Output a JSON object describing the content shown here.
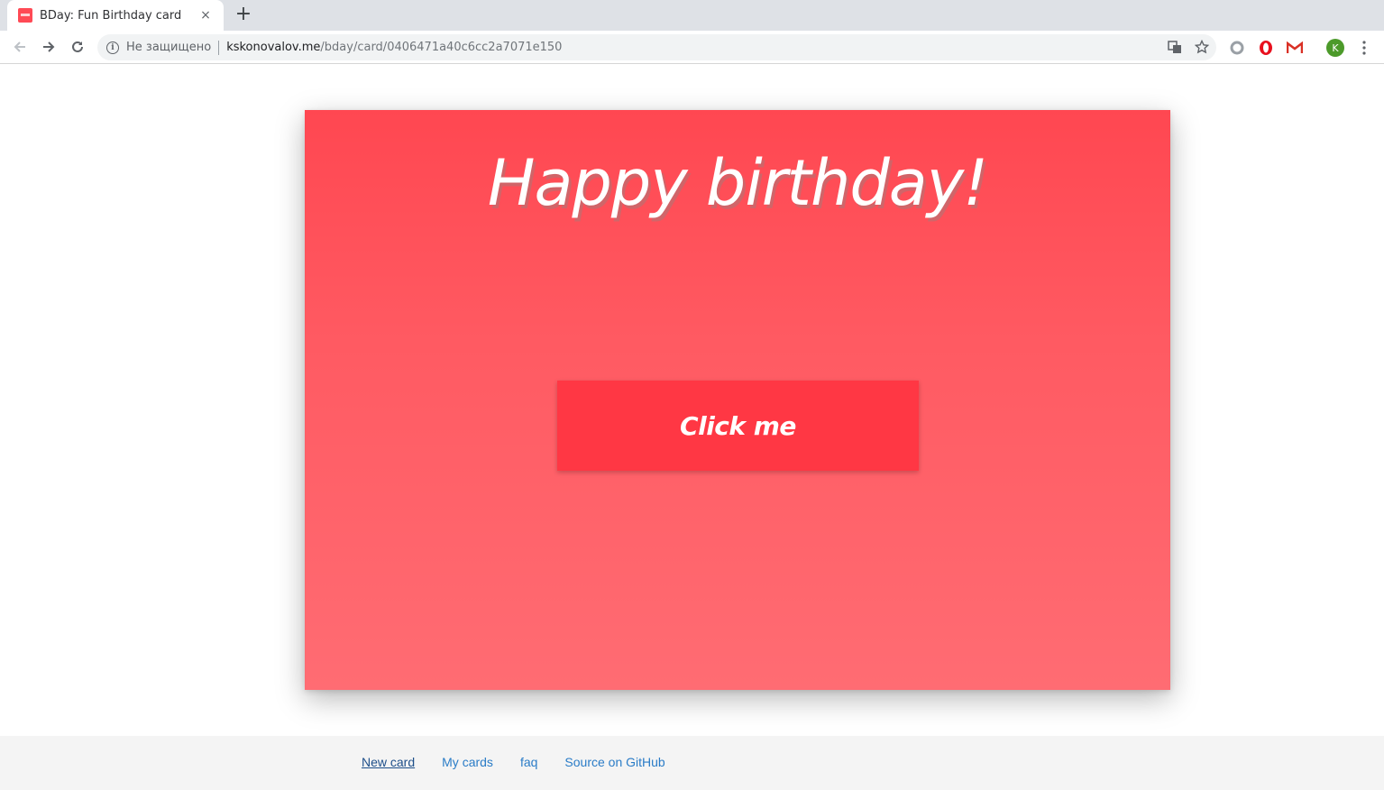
{
  "browser": {
    "tab_title": "BDay: Fun Birthday card",
    "tab_close": "×",
    "new_tab": "+",
    "security_label": "Не защищено",
    "url_host": "kskonovalov.me",
    "url_path": "/bday/card/0406471a40c6cc2a7071e150",
    "profile_initial": "K",
    "accent_profile": "#4c9a2a"
  },
  "card": {
    "title": "Happy birthday!",
    "button_label": "Click me",
    "background_top": "#ff4751",
    "background_bottom": "#ff6c73",
    "button_color": "#ff3744"
  },
  "footer": {
    "links": [
      "New card",
      "My cards",
      "faq",
      "Source on GitHub"
    ]
  }
}
